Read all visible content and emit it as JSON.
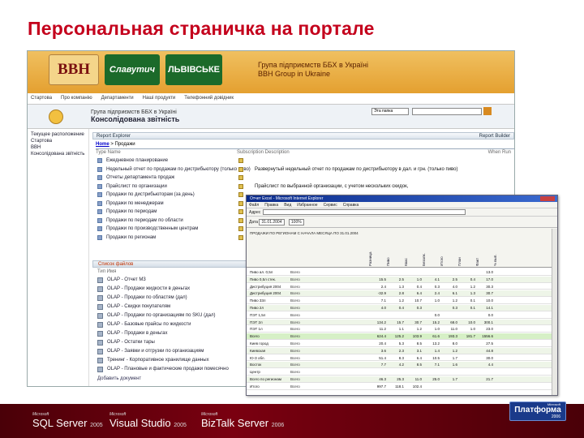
{
  "slide": {
    "title": "Персональная страничка на портале"
  },
  "portal": {
    "logos": {
      "bbh": "BBH",
      "slav": "Славутич",
      "lviv": "ЛЬВІВСЬКЕ"
    },
    "header_line1": "Група підприємств ББХ в Україні",
    "header_line2": "BBH Group in Ukraine",
    "nav": [
      "Стартова",
      "Про компанію",
      "Департаменти",
      "Наші продукти",
      "Телефонний довідник"
    ],
    "site_line1": "Група підприємств ББХ в Україні",
    "site_line2": "Консолідована звітність",
    "search_scope": "Эта папка",
    "left_nav": [
      "Текущее расположение",
      "Стартова",
      "BBH",
      "Консолідована звітність"
    ],
    "report_explorer": "Report Explorer",
    "report_builder": "Report Builder",
    "breadcrumb_home": "Home",
    "breadcrumb_sep": " > ",
    "breadcrumb_page": "Продажи",
    "col_type": "Type  Name",
    "col_desc": "Subscription  Description",
    "col_when": "When Run",
    "reports": [
      {
        "name": "Ежедневное планирование",
        "desc": ""
      },
      {
        "name": "Недельный отчет по продажам по дистрибьютору (только пиво)",
        "desc": "Развернутый недельный отчет по продажам по дистрибьютору в дал. и грн. (только пиво)"
      },
      {
        "name": "Отчеты департамента продаж",
        "desc": ""
      },
      {
        "name": "Прайслист по организации",
        "desc": "Прайслист по выбранной организации, с учетом нескольких скидок,"
      },
      {
        "name": "Продажи по дистрибьюторам (за день)",
        "desc": ""
      },
      {
        "name": "Продажи по менеджерам",
        "desc": ""
      },
      {
        "name": "Продажи по периодам",
        "desc": ""
      },
      {
        "name": "Продажи по периодам по области",
        "desc": ""
      },
      {
        "name": "Продажи по производственным центрам",
        "desc": ""
      },
      {
        "name": "Продажи по регионам",
        "desc": ""
      }
    ],
    "olap_header": "Список файлов",
    "olap_col": "Тип  Имя",
    "olap_items": [
      "OLAP - Отчет M3",
      "OLAP - Продажи жидкости в деньгах",
      "OLAP - Продажи по областям (дал)",
      "OLAP - Скидки покупателям",
      "OLAP - Продажи по организациям по SKU (дал)",
      "OLAP - Базовые прайсы по жидкости",
      "OLAP - Продажи в деньгах",
      "OLAP - Остатки тары",
      "OLAP - Заявки и отгрузки по организациям",
      "Тренинг - Корпоративное хранилище данных",
      "OLAP - Плановые и фактические продажи помесячно"
    ],
    "add_document": "Добавить документ"
  },
  "excel": {
    "title": "Отчет Excel - Microsoft Internet Explorer",
    "menu": [
      "Файл",
      "Правка",
      "Вид",
      "Избранное",
      "Сервис",
      "Справка"
    ],
    "address_label": "Адрес",
    "zoom": "100%",
    "date_label": "Дата",
    "date_value": "31.01.2004",
    "head_label": "ПРОДАЖИ ПО РЕГИОНАМ С НАЧАЛА МЕСЯЦА ПО 31.01.2004",
    "col_heads": [
      "Разница",
      "Пиво",
      "Квас",
      "Безалк.",
      "Итого",
      "План",
      "Факт",
      "% вып."
    ],
    "rows": [
      {
        "r0": "Пиво ал. 0,5л",
        "r1": "Всего",
        "vals": [
          "",
          "",
          "",
          "",
          "",
          "",
          "13.0",
          ""
        ]
      },
      {
        "r0": "Пиво 0,5л стек.",
        "r1": "Всего",
        "vals": [
          "15.5",
          "2.5",
          "1.0",
          "4.1",
          "2.5",
          "0.4",
          "17.0",
          ""
        ]
      },
      {
        "r0": "Дистрибуция 2004",
        "r1": "Всего",
        "vals": [
          "2.4",
          "1.3",
          "0.4",
          "0.3",
          "4.0",
          "1.2",
          "30.3",
          ""
        ]
      },
      {
        "r0": "Дистрибуция 2004",
        "r1": "Всего",
        "vals": [
          "-32.9",
          "2.8",
          "6.4",
          "2.4",
          "6.1",
          "1.3",
          "30.7",
          ""
        ]
      },
      {
        "r0": "Пиво 33л",
        "r1": "Всего",
        "vals": [
          "7.1",
          "1.2",
          "10.7",
          "1.0",
          "1.2",
          "0.1",
          "10.0",
          ""
        ]
      },
      {
        "r0": "Пиво 2л",
        "r1": "Всего",
        "vals": [
          "4.0",
          "0.4",
          "0.3",
          "",
          "0.3",
          "0.1",
          "14.1",
          ""
        ]
      },
      {
        "r0": "ПЭТ 1,5л",
        "r1": "Всего",
        "vals": [
          "",
          "",
          "",
          "0.0",
          "",
          "",
          "0.0",
          ""
        ]
      },
      {
        "r0": "ПЭТ 2л",
        "r1": "Всего",
        "vals": [
          "134.2",
          "15.7",
          "30.7",
          "15.2",
          "68.0",
          "10.0",
          "300.1",
          ""
        ]
      },
      {
        "r0": "ПЭТ 1л",
        "r1": "Всего",
        "vals": [
          "11.2",
          "1.1",
          "1.2",
          "1.0",
          "11.0",
          "1.0",
          "23.0",
          ""
        ]
      },
      {
        "r0": "Всего",
        "r1": "Всего",
        "vals": [
          "624.4",
          "125.2",
          "103.9",
          "61.6",
          "193.3",
          "181.7",
          "1556.6",
          ""
        ]
      },
      {
        "r0": "Киев город",
        "r1": "Всего",
        "vals": [
          "20.4",
          "5.3",
          "8.5",
          "13.2",
          "8.0",
          "",
          "27.5",
          ""
        ]
      },
      {
        "r0": "Киевская",
        "r1": "Всего",
        "vals": [
          "3.6",
          "2.3",
          "3.1",
          "1.4",
          "1.2",
          "",
          "44.8",
          ""
        ]
      },
      {
        "r0": "Ю-З обл.",
        "r1": "Всего",
        "vals": [
          "51.4",
          "8.3",
          "6.4",
          "10.5",
          "1.7",
          "",
          "30.0",
          ""
        ]
      },
      {
        "r0": "Восток",
        "r1": "Всего",
        "vals": [
          "7.7",
          "4.2",
          "8.5",
          "7.1",
          "1.6",
          "",
          "4.4",
          ""
        ]
      },
      {
        "r0": "Центр",
        "r1": "Всего",
        "vals": [
          "",
          "",
          "",
          "",
          "",
          "",
          "",
          ""
        ]
      },
      {
        "r0": "Всего по регионам",
        "r1": "Всего",
        "vals": [
          "46.3",
          "25.3",
          "11.0",
          "25.0",
          "1.7",
          "",
          "21.7",
          ""
        ]
      },
      {
        "r0": "Итого",
        "r1": "Всего",
        "vals": [
          "997.7",
          "118.1",
          "102.4",
          "",
          "",
          "",
          "",
          ""
        ]
      }
    ]
  },
  "footer": {
    "products": [
      {
        "ms": "Microsoft",
        "name": "SQL Server",
        "year": "2005"
      },
      {
        "ms": "Microsoft",
        "name": "Visual Studio",
        "year": "2005"
      },
      {
        "ms": "Microsoft",
        "name": "BizTalk Server",
        "year": "2006"
      }
    ],
    "platform": {
      "ms": "Microsoft",
      "name": "Платформа",
      "year": "2006"
    }
  }
}
